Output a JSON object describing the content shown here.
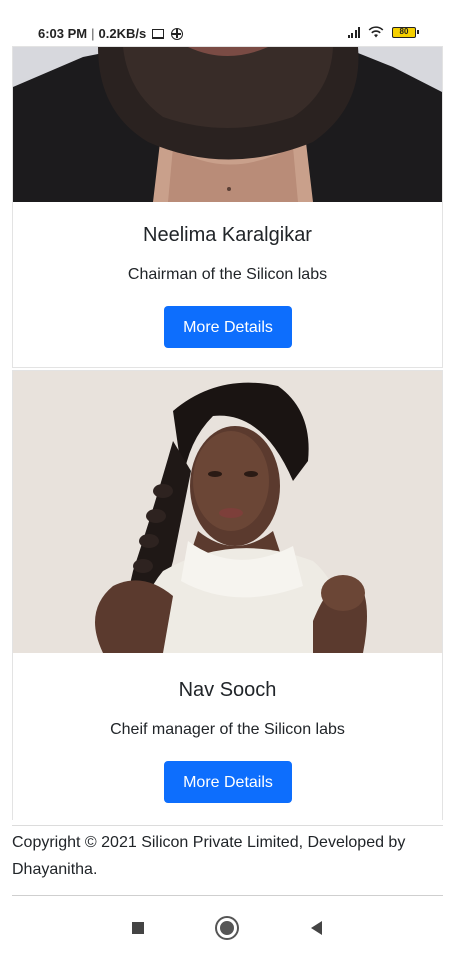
{
  "status_bar": {
    "time": "6:03 PM",
    "separator": "|",
    "net_speed": "0.2KB/s",
    "battery_level": "80",
    "icons": [
      "screen-icon",
      "vpn-globe-icon",
      "signal-icon",
      "wifi-icon",
      "battery-icon"
    ]
  },
  "cards": [
    {
      "name": "Neelima Karalgikar",
      "role": "Chairman of the Silicon labs",
      "button_label": "More Details",
      "photo": "bearded-man-portrait"
    },
    {
      "name": "Nav Sooch",
      "role": "Cheif manager of the Silicon labs",
      "button_label": "More Details",
      "photo": "woman-portrait-braid"
    }
  ],
  "footer": {
    "copyright": "Copyright © 2021 Silicon Private Limited, Developed by Dhayanitha."
  },
  "nav_bar": {
    "icons": [
      "recents-square-icon",
      "home-circle-icon",
      "back-triangle-icon"
    ]
  },
  "colors": {
    "primary_button": "#0d6efd",
    "text": "#212529",
    "battery": "#f5d000"
  }
}
